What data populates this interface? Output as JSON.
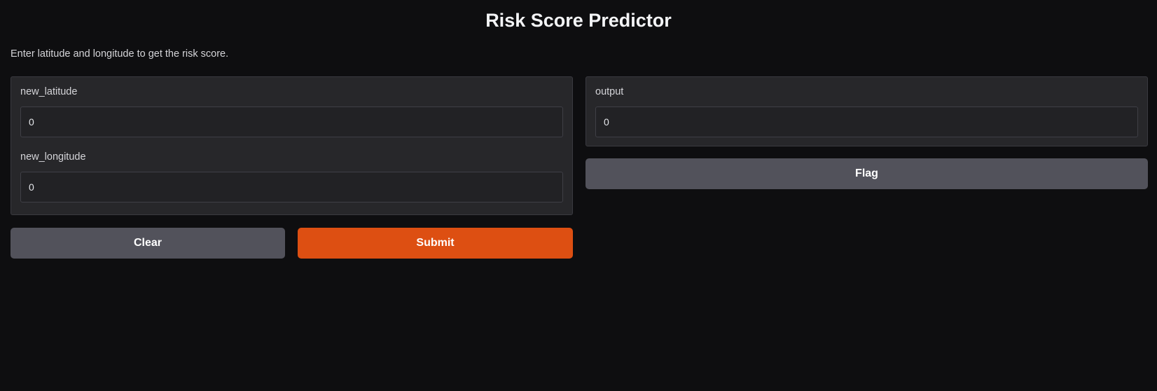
{
  "app": {
    "title": "Risk Score Predictor",
    "description": "Enter latitude and longitude to get the risk score."
  },
  "inputs": {
    "latitude": {
      "label": "new_latitude",
      "value": "0"
    },
    "longitude": {
      "label": "new_longitude",
      "value": "0"
    }
  },
  "outputs": {
    "result": {
      "label": "output",
      "value": "0"
    }
  },
  "buttons": {
    "clear_label": "Clear",
    "submit_label": "Submit",
    "flag_label": "Flag"
  },
  "colors": {
    "background": "#0e0e10",
    "panel": "#27272a",
    "primary_button": "#dd4f12",
    "secondary_button": "#52525b"
  }
}
